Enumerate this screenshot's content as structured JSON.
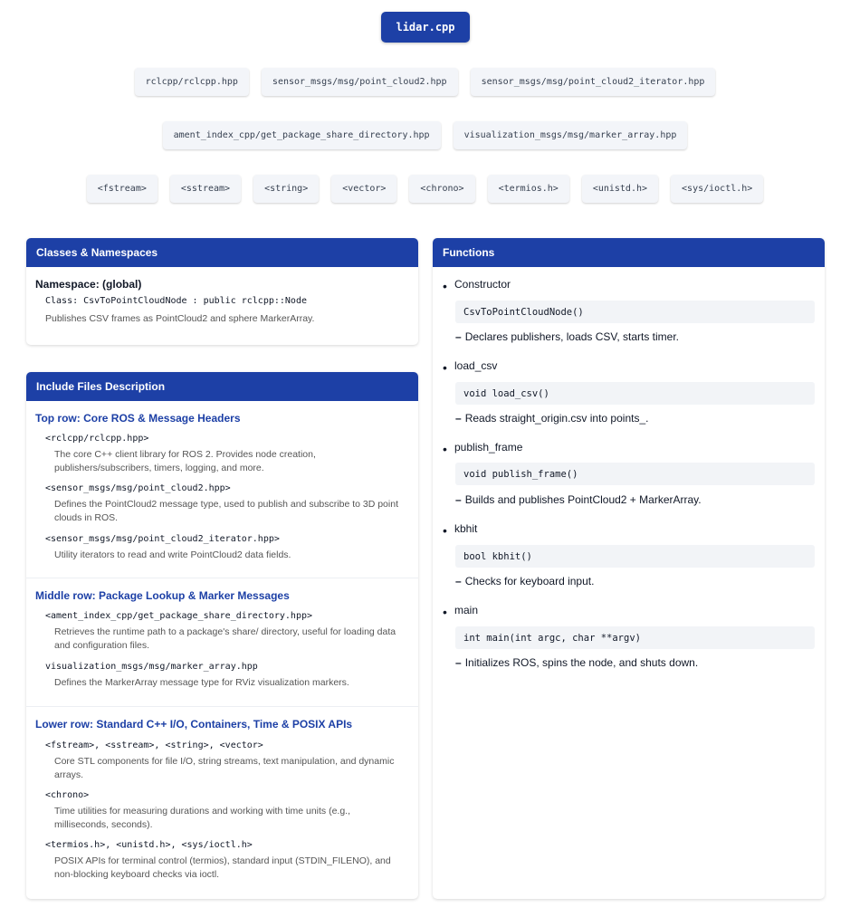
{
  "file": {
    "name": "lidar.cpp"
  },
  "include_rows": [
    [
      "rclcpp/rclcpp.hpp",
      "sensor_msgs/msg/point_cloud2.hpp",
      "sensor_msgs/msg/point_cloud2_iterator.hpp"
    ],
    [
      "ament_index_cpp/get_package_share_directory.hpp",
      "visualization_msgs/msg/marker_array.hpp"
    ],
    [
      "<fstream>",
      "<sstream>",
      "<string>",
      "<vector>",
      "<chrono>",
      "<termios.h>",
      "<unistd.h>",
      "<sys/ioctl.h>"
    ]
  ],
  "classes_panel": {
    "title": "Classes & Namespaces",
    "namespace": "Namespace: (global)",
    "class_line": "Class: CsvToPointCloudNode : public rclcpp::Node",
    "description": "Publishes CSV frames as PointCloud2 and sphere MarkerArray."
  },
  "includes_panel": {
    "title": "Include Files Description",
    "sections": [
      {
        "title": "Top row: Core ROS & Message Headers",
        "items": [
          {
            "name": "<rclcpp/rclcpp.hpp>",
            "desc": "The core C++ client library for ROS 2. Provides node creation, publishers/subscribers, timers, logging, and more."
          },
          {
            "name": "<sensor_msgs/msg/point_cloud2.hpp>",
            "desc": "Defines the PointCloud2 message type, used to publish and subscribe to 3D point clouds in ROS."
          },
          {
            "name": "<sensor_msgs/msg/point_cloud2_iterator.hpp>",
            "desc": "Utility iterators to read and write PointCloud2 data fields."
          }
        ]
      },
      {
        "title": "Middle row: Package Lookup & Marker Messages",
        "items": [
          {
            "name": "<ament_index_cpp/get_package_share_directory.hpp>",
            "desc": "Retrieves the runtime path to a package's share/ directory, useful for loading data and configuration files."
          },
          {
            "name": "visualization_msgs/msg/marker_array.hpp",
            "desc": "Defines the MarkerArray message type for RViz visualization markers."
          }
        ]
      },
      {
        "title": "Lower row: Standard C++ I/O, Containers, Time & POSIX APIs",
        "items": [
          {
            "name": "<fstream>, <sstream>, <string>, <vector>",
            "desc": "Core STL components for file I/O, string streams, text manipulation, and dynamic arrays."
          },
          {
            "name": "<chrono>",
            "desc": "Time utilities for measuring durations and working with time units (e.g., milliseconds, seconds)."
          },
          {
            "name": "<termios.h>, <unistd.h>, <sys/ioctl.h>",
            "desc": "POSIX APIs for terminal control (termios), standard input (STDIN_FILENO), and non-blocking keyboard checks via ioctl."
          }
        ]
      }
    ]
  },
  "functions_panel": {
    "title": "Functions",
    "bullet": "•",
    "dash": "–",
    "items": [
      {
        "name": "Constructor",
        "signature": "CsvToPointCloudNode()",
        "desc": "Declares publishers, loads CSV, starts timer."
      },
      {
        "name": "load_csv",
        "signature": "void load_csv()",
        "desc": "Reads straight_origin.csv into points_."
      },
      {
        "name": "publish_frame",
        "signature": "void publish_frame()",
        "desc": "Builds and publishes PointCloud2 + MarkerArray."
      },
      {
        "name": "kbhit",
        "signature": "bool kbhit()",
        "desc": "Checks for keyboard input."
      },
      {
        "name": "main",
        "signature": "int main(int argc, char **argv)",
        "desc": "Initializes ROS, spins the node, and shuts down."
      }
    ]
  }
}
